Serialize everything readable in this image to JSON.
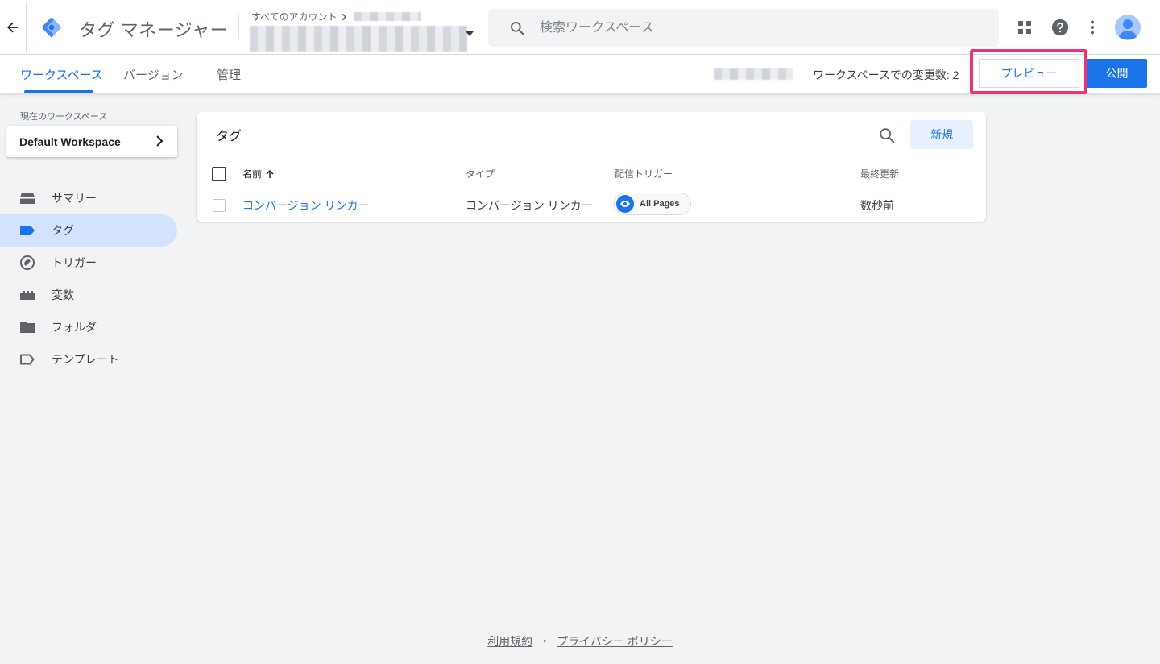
{
  "header": {
    "app_title": "タグ マネージャー",
    "account_crumb": "すべてのアカウント",
    "search_placeholder": "検索ワークスペース"
  },
  "subnav": {
    "tabs": [
      {
        "label": "ワークスペース",
        "active": true
      },
      {
        "label": "バージョン",
        "active": false
      },
      {
        "label": "管理",
        "active": false
      }
    ],
    "changes_label": "ワークスペースでの変更数: 2",
    "preview_label": "プレビュー",
    "publish_label": "公開"
  },
  "sidebar": {
    "workspace_label": "現在のワークスペース",
    "workspace_name": "Default Workspace",
    "items": [
      {
        "label": "サマリー",
        "icon": "summary-icon",
        "active": false
      },
      {
        "label": "タグ",
        "icon": "tag-icon",
        "active": true
      },
      {
        "label": "トリガー",
        "icon": "trigger-icon",
        "active": false
      },
      {
        "label": "変数",
        "icon": "variable-icon",
        "active": false
      },
      {
        "label": "フォルダ",
        "icon": "folder-icon",
        "active": false
      },
      {
        "label": "テンプレート",
        "icon": "template-icon",
        "active": false
      }
    ]
  },
  "tags_card": {
    "title": "タグ",
    "new_label": "新規",
    "columns": [
      "名前",
      "タイプ",
      "配信トリガー",
      "最終更新"
    ],
    "rows": [
      {
        "name": "コンバージョン リンカー",
        "type": "コンバージョン リンカー",
        "trigger": "All Pages",
        "updated": "数秒前"
      }
    ]
  },
  "footer": {
    "terms": "利用規約",
    "separator": "・",
    "privacy": "プライバシー ポリシー"
  },
  "colors": {
    "accent": "#1a73e8",
    "highlight": "#f0346f",
    "active_nav": "#d3e3fd"
  }
}
